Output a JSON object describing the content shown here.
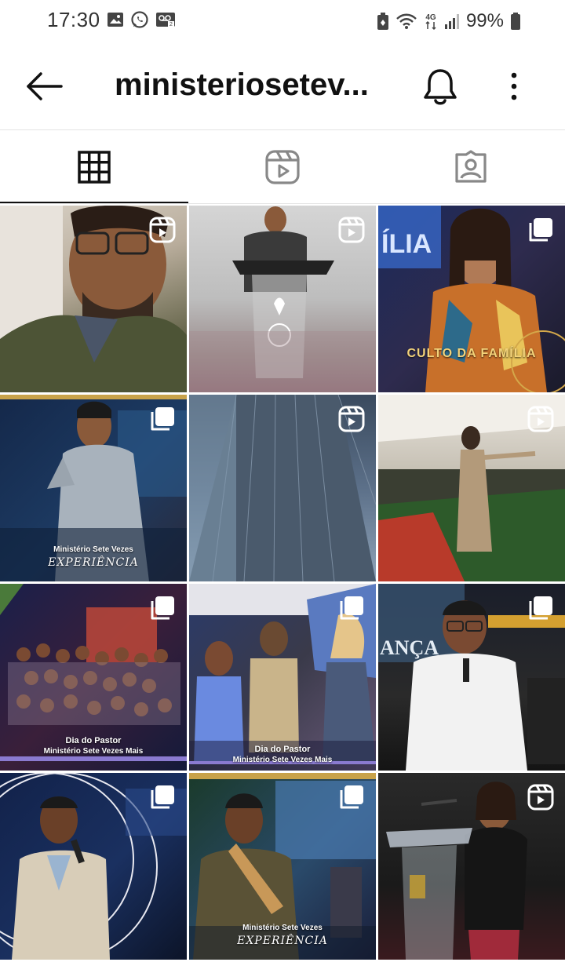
{
  "status_bar": {
    "time": "17:30",
    "battery": "99%",
    "network": "4G",
    "left_icons": [
      "image-icon",
      "whatsapp-icon",
      "voicemail-icon"
    ],
    "right_icons": [
      "battery-saver-icon",
      "wifi-icon",
      "network-4g-icon",
      "signal-icon",
      "battery-icon"
    ]
  },
  "header": {
    "title": "ministeriosetev...",
    "back_icon": "arrow-left-icon",
    "notifications_icon": "bell-icon",
    "more_icon": "more-vertical-icon"
  },
  "tabs": [
    {
      "icon": "grid-icon",
      "active": true
    },
    {
      "icon": "reels-icon",
      "active": false
    },
    {
      "icon": "tagged-icon",
      "active": false
    }
  ],
  "posts": [
    {
      "type": "reel",
      "badge": "reels-icon",
      "caption": ""
    },
    {
      "type": "reel",
      "badge": "reels-icon",
      "caption": ""
    },
    {
      "type": "carousel",
      "badge": "carousel-icon",
      "caption": "CULTO DA FAMÍLIA"
    },
    {
      "type": "carousel",
      "badge": "carousel-icon",
      "caption_top": "Ministério Sete Vezes",
      "caption": "EXPERIÊNCIA"
    },
    {
      "type": "reel",
      "badge": "reels-icon",
      "caption": ""
    },
    {
      "type": "reel",
      "badge": "reels-icon",
      "caption": ""
    },
    {
      "type": "carousel",
      "badge": "carousel-icon",
      "caption_top": "Dia do Pastor",
      "caption": "Ministério Sete Vezes Mais"
    },
    {
      "type": "carousel",
      "badge": "carousel-icon",
      "caption_top": "Dia do Pastor",
      "caption": "Ministério Sete Vezes Mais"
    },
    {
      "type": "carousel",
      "badge": "carousel-icon",
      "caption": ""
    },
    {
      "type": "carousel",
      "badge": "carousel-icon",
      "caption": ""
    },
    {
      "type": "carousel",
      "badge": "carousel-icon",
      "caption_top": "Ministério Sete Vezes",
      "caption": "EXPERIÊNCIA"
    },
    {
      "type": "reel",
      "badge": "reels-icon",
      "caption": ""
    }
  ]
}
